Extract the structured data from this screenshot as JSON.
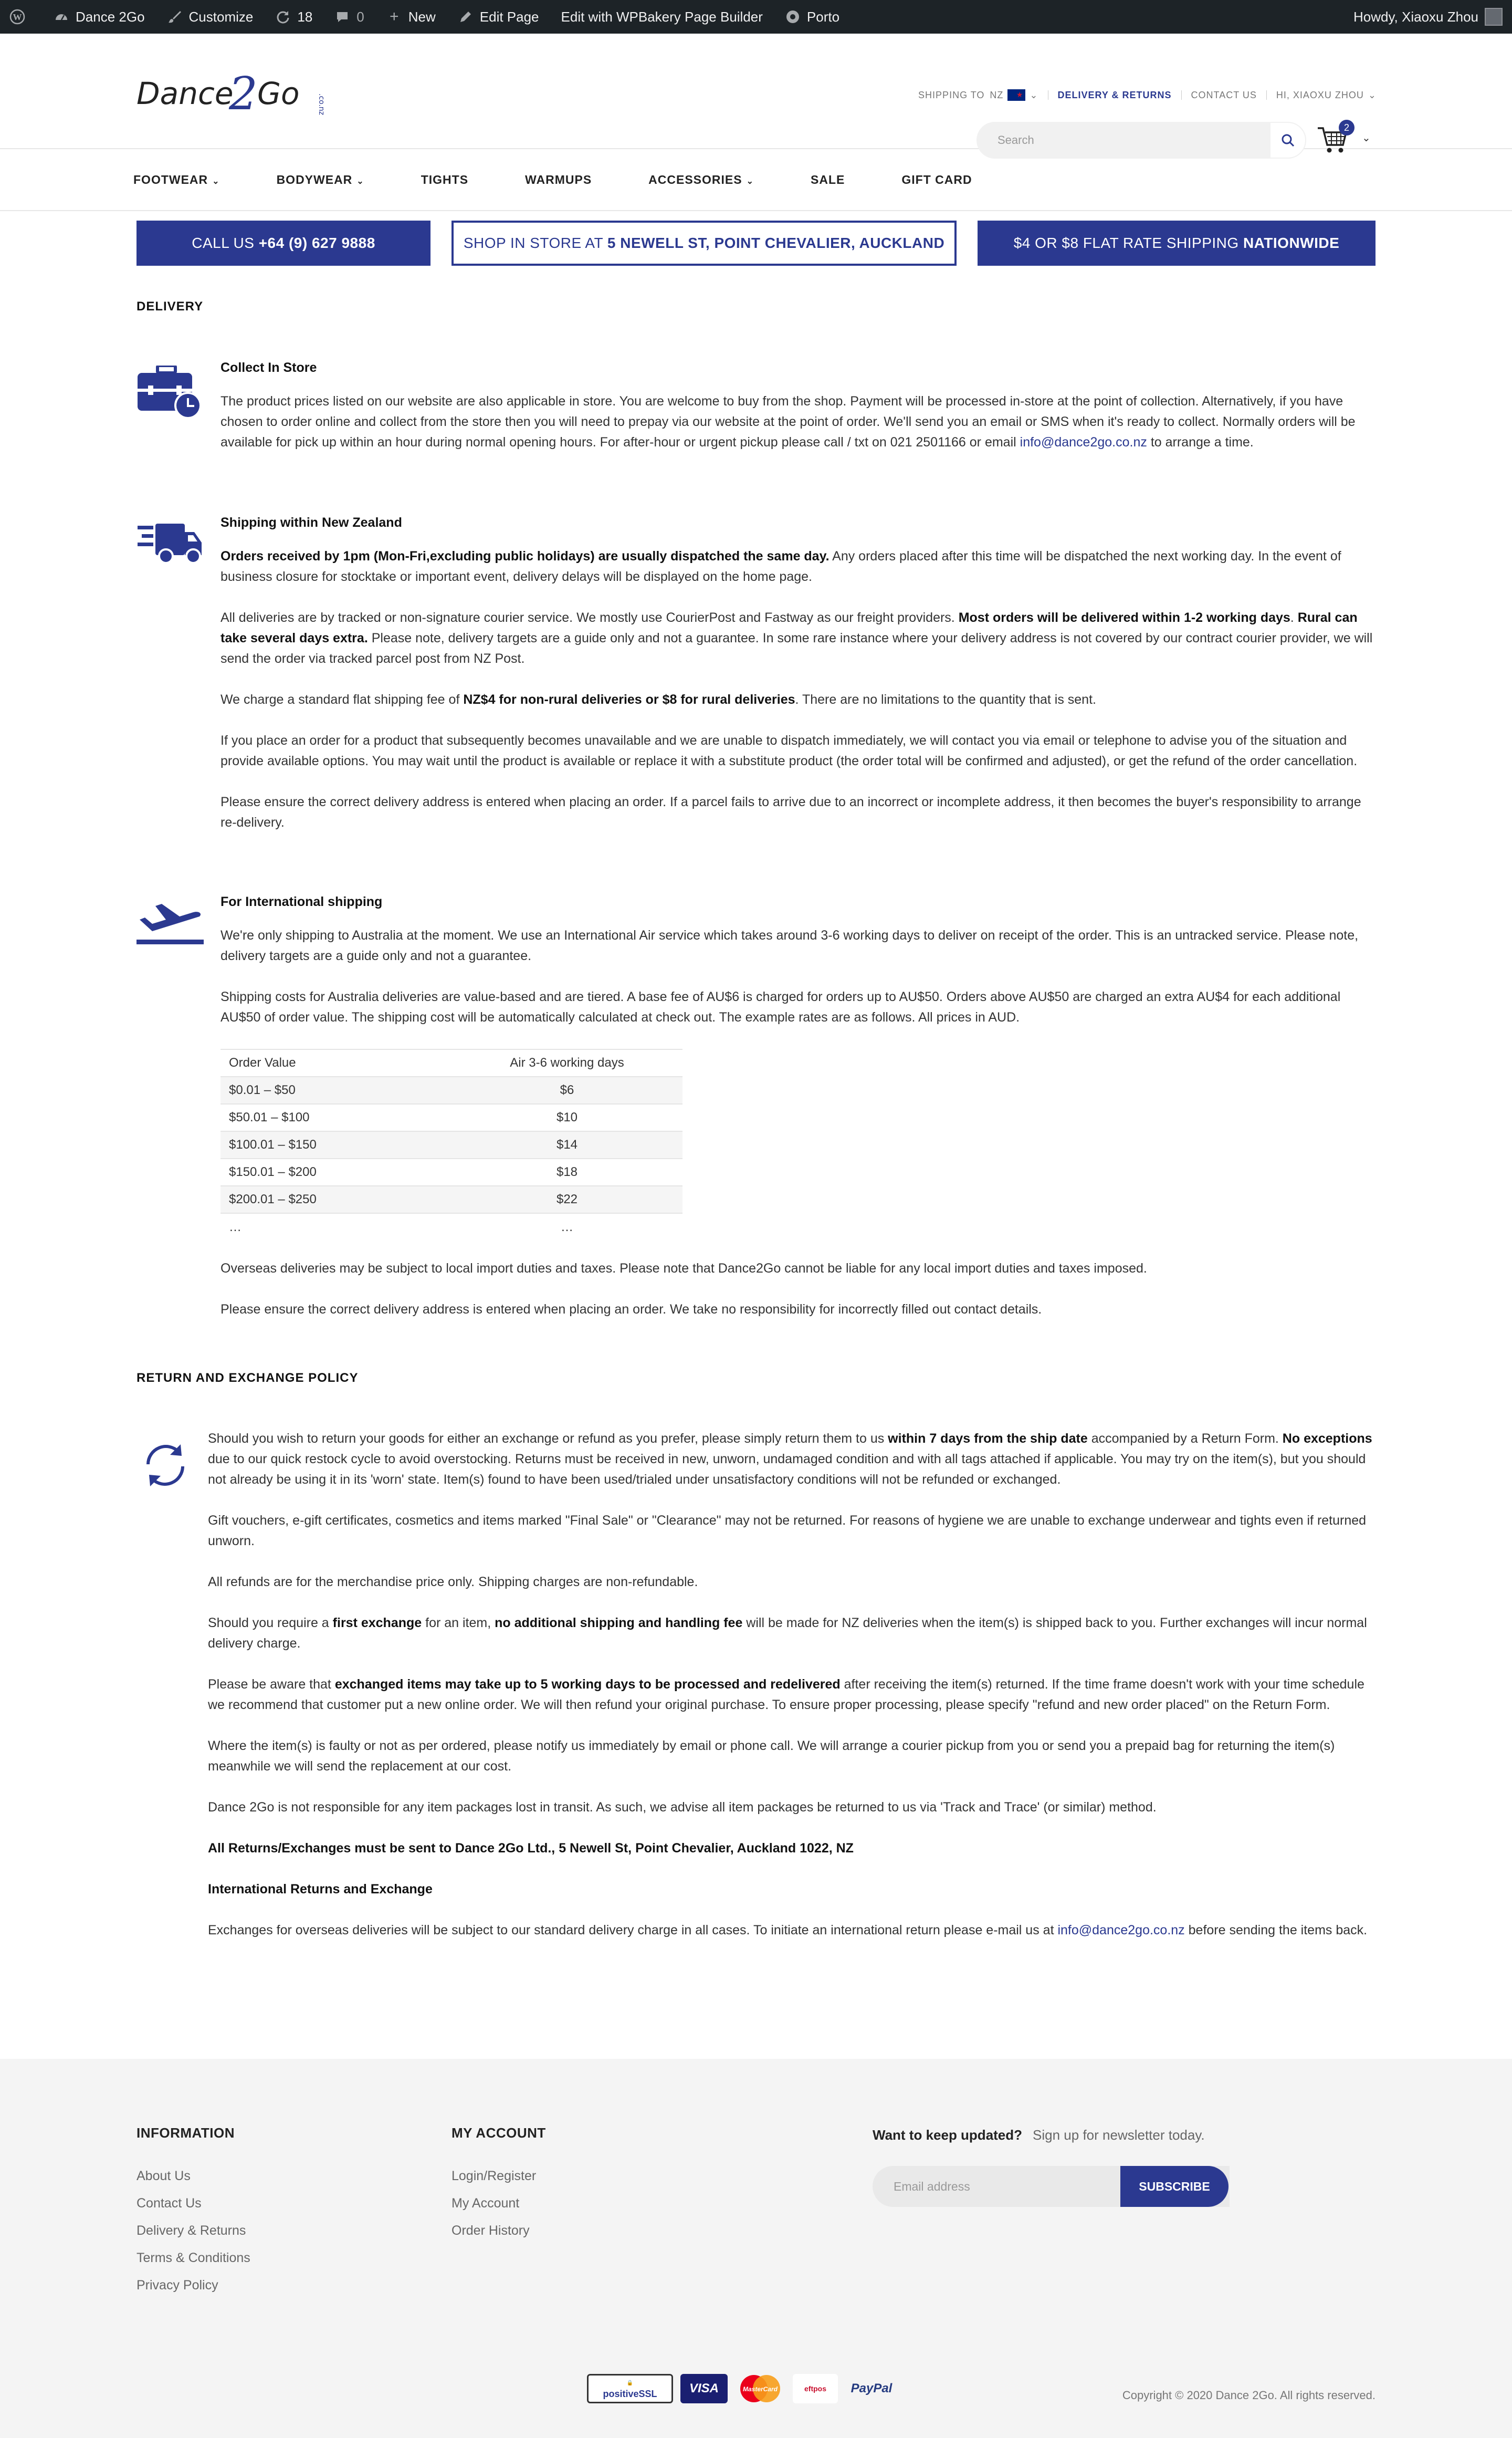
{
  "admin_bar": {
    "site_name": "Dance 2Go",
    "customize": "Customize",
    "updates": "18",
    "comments": "0",
    "new": "New",
    "edit_page": "Edit Page",
    "wpbakery": "Edit with WPBakery Page Builder",
    "theme": "Porto",
    "howdy": "Howdy, Xiaoxu Zhou"
  },
  "header": {
    "logo_text": "Dance2Go",
    "logo_tld": ".co.nz",
    "shipping_to": "SHIPPING TO",
    "country": "NZ",
    "delivery_link": "DELIVERY & RETURNS",
    "contact_link": "CONTACT US",
    "user": "HI, XIAOXU ZHOU",
    "search_placeholder": "Search",
    "cart_count": "2"
  },
  "nav": [
    "FOOTWEAR",
    "BODYWEAR",
    "TIGHTS",
    "WARMUPS",
    "ACCESSORIES",
    "SALE",
    "GIFT CARD"
  ],
  "promo": {
    "call_prefix": "CALL US ",
    "call_number": "+64 (9) 627 9888",
    "shop_prefix": "SHOP IN STORE AT ",
    "shop_address": "5 NEWELL ST, POINT CHEVALIER, AUCKLAND",
    "ship_prefix": "$4 OR $8 FLAT RATE SHIPPING ",
    "ship_suffix": "NATIONWIDE"
  },
  "delivery": {
    "heading": "DELIVERY",
    "collect": {
      "title": "Collect In Store",
      "text": "The product prices listed on our website are also applicable in store. You are welcome to buy from the shop. Payment will be processed in-store at the point of collection. Alternatively, if you have chosen to order online and collect from the store then you will need to prepay via our website at the point of order. We'll send you an email or SMS when it's ready to collect. Normally orders will be available for pick up within an hour during normal opening hours. For after-hour or urgent pickup please call / txt on 021 2501166 or email",
      "email": "info@dance2go.co.nz",
      "text_end": " to arrange a time."
    },
    "nz": {
      "title": "Shipping within New Zealand",
      "p1_bold": "Orders received by 1pm (Mon-Fri,excluding public holidays) are usually dispatched the same day.",
      "p1_rest": " Any orders placed after this time will be dispatched the next working day. In the event of business closure for stocktake or important event, delivery delays will be displayed on the home page.",
      "p2_a": "All deliveries are by tracked or non-signature courier service. We mostly use CourierPost and Fastway as our freight providers. ",
      "p2_b": "Most orders will be delivered within 1-2 working days",
      "p2_c": ". ",
      "p2_d": "Rural can take several days extra.",
      "p2_e": " Please note, delivery targets are a guide only and not a guarantee. In some rare instance where your delivery address is not covered by our contract courier provider, we will send the order via tracked parcel post from NZ Post.",
      "p3_a": "We charge a standard flat shipping fee of ",
      "p3_b": "NZ$4 for non-rural deliveries or $8 for rural deliveries",
      "p3_c": ". There are no limitations to the quantity that is sent.",
      "p4": "If you place an order for a product that subsequently becomes unavailable and we are unable to dispatch immediately, we will contact you via email or telephone to advise you of the situation and provide available options. You may wait until the product is available or replace it with a substitute product (the order total will be confirmed and adjusted), or get the refund of the order cancellation.",
      "p5": "Please ensure the correct delivery address is entered when placing an order. If a parcel fails to arrive due to an incorrect or incomplete address, it then becomes the buyer's responsibility to arrange re-delivery."
    },
    "intl": {
      "title": "For International shipping",
      "p1": "We're only shipping to Australia at the moment. We use an International Air service which takes around 3-6 working days to deliver on receipt of the order. This is an untracked service. Please note, delivery targets are a guide only and not a guarantee.",
      "p2": "Shipping costs for Australia deliveries are value-based and are tiered. A base fee of AU$6 is charged for orders up to AU$50. Orders above AU$50 are charged an extra AU$4 for each additional AU$50 of order value. The shipping cost will be automatically calculated at check out.  The example rates are as follows. All prices in AUD.",
      "table_headers": [
        "Order Value",
        "Air 3-6 working days"
      ],
      "table_rows": [
        [
          "$0.01 – $50",
          "$6"
        ],
        [
          "$50.01 – $100",
          "$10"
        ],
        [
          "$100.01 – $150",
          "$14"
        ],
        [
          "$150.01 – $200",
          "$18"
        ],
        [
          "$200.01 – $250",
          "$22"
        ],
        [
          "…",
          "…"
        ]
      ],
      "p3": "Overseas deliveries may be subject to local import duties and taxes. Please note that Dance2Go cannot be liable for any local import duties and taxes imposed.",
      "p4": "Please ensure the correct delivery address is entered when placing an order. We take no responsibility for incorrectly filled out contact details."
    }
  },
  "returns": {
    "heading": "RETURN AND EXCHANGE POLICY",
    "p1_a": "Should you wish to return your goods for either an exchange or refund as you prefer, please simply return them to us ",
    "p1_b": "within 7 days from the ship date",
    "p1_c": " accompanied by a Return Form. ",
    "p1_d": "No exceptions",
    "p1_e": " due to our quick restock cycle to avoid overstocking. Returns must be received in new, unworn, undamaged condition and with all tags attached if applicable. You may try on the item(s), but you should not already be using it in its 'worn' state. Item(s) found to have been used/trialed under unsatisfactory conditions will not be refunded or exchanged.",
    "p2": "Gift vouchers, e-gift certificates, cosmetics and items marked \"Final Sale\" or \"Clearance\" may not be returned. For reasons of hygiene we are unable to exchange underwear and tights even if returned unworn.",
    "p3": "All refunds are for the merchandise price only. Shipping charges are non-refundable.",
    "p4_a": "Should you require a ",
    "p4_b": "first exchange",
    "p4_c": " for an item, ",
    "p4_d": "no additional shipping and handling fee",
    "p4_e": " will be made for NZ deliveries when the item(s) is shipped back to you. Further exchanges will incur normal delivery charge.",
    "p5_a": "Please be aware that ",
    "p5_b": "exchanged items may take up to 5 working days to be processed and redelivered",
    "p5_c": " after receiving the item(s) returned. If the time frame doesn't work with your time schedule we recommend that customer put a new online order. We will then refund your original purchase. To ensure proper processing, please specify \"refund and new order placed\" on the Return Form.",
    "p6": "Where the item(s) is faulty or not as per ordered, please notify us immediately by email or phone call. We will arrange a courier pickup from you or send you a prepaid bag for returning the item(s) meanwhile we will send the replacement at our cost.",
    "p7": "Dance 2Go is not responsible for any item packages lost in transit. As such, we advise all item packages be returned to us via 'Track and Trace' (or similar) method.",
    "p8": "All Returns/Exchanges must be sent to Dance 2Go Ltd., 5 Newell St, Point Chevalier, Auckland 1022, NZ",
    "intl_title": "International Returns and Exchange",
    "p9_a": "Exchanges for overseas deliveries will be subject to our standard delivery charge in all cases. To initiate an international return please e-mail us at ",
    "p9_email": "info@dance2go.co.nz",
    "p9_b": " before sending the items back."
  },
  "footer": {
    "info_heading": "INFORMATION",
    "info_links": [
      "About Us",
      "Contact Us",
      "Delivery & Returns",
      "Terms & Conditions",
      "Privacy Policy"
    ],
    "account_heading": "MY ACCOUNT",
    "account_links": [
      "Login/Register",
      "My Account",
      "Order History"
    ],
    "newsletter_q": "Want to keep updated?",
    "newsletter_s": "Sign up for newsletter today.",
    "email_placeholder": "Email address",
    "subscribe": "SUBSCRIBE",
    "payments": [
      "positiveSSL",
      "VISA",
      "MasterCard",
      "eftpos",
      "PayPal"
    ],
    "copyright": "Copyright © 2020 Dance 2Go. All rights reserved."
  },
  "colors": {
    "brand": "#2b3990",
    "admin_bar": "#1d2327",
    "footer_bg": "#f4f4f4"
  }
}
